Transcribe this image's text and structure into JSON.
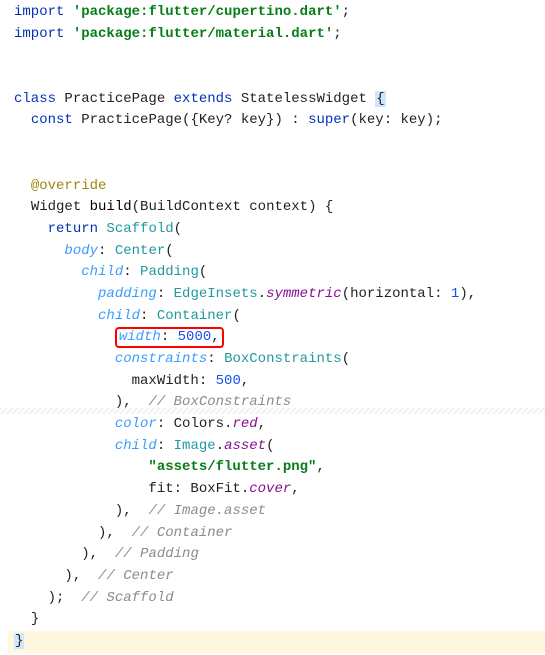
{
  "lines": {
    "l1_import": "import",
    "l1_pkg": "'package:flutter/cupertino.dart'",
    "l1_semi": ";",
    "l2_import": "import",
    "l2_pkg": "'package:flutter/material.dart'",
    "l2_semi": ";",
    "l4_class": "class",
    "l4_name": " PracticePage ",
    "l4_extends": "extends",
    "l4_parent": " StatelessWidget ",
    "l4_brace": "{",
    "l5_const": "const",
    "l5_ctor": " PracticePage({Key? key}) : ",
    "l5_super": "super",
    "l5_rest": "(key: key);",
    "l7_override": "@override",
    "l8_widget": "Widget ",
    "l8_build": "build",
    "l8_sig": "(BuildContext context) {",
    "l9_return": "return",
    "l9_scaffold": " Scaffold",
    "l9_paren": "(",
    "l10_body": "body",
    "l10_center": "Center",
    "l10_paren": "(",
    "l11_child": "child",
    "l11_padding": "Padding",
    "l11_paren": "(",
    "l12_padding": "padding",
    "l12_edge": "EdgeInsets",
    "l12_sym": "symmetric",
    "l12_horiz": "(horizontal: ",
    "l12_num": "1",
    "l12_end": "),",
    "l13_child": "child",
    "l13_container": "Container",
    "l13_paren": "(",
    "l14_width": "width",
    "l14_val": "5000",
    "l14_comma": ",",
    "l15_constraints": "constraints",
    "l15_box": "BoxConstraints",
    "l15_paren": "(",
    "l16_max": "maxWidth: ",
    "l16_val": "500",
    "l16_comma": ",",
    "l17_close": "),",
    "l17_cmt": "  // BoxConstraints",
    "l18_color": "color",
    "l18_colors": ": Colors.",
    "l18_red": "red",
    "l18_comma": ",",
    "l19_child": "child",
    "l19_image": "Image",
    "l19_asset": "asset",
    "l19_paren": "(",
    "l20_str": "\"assets/flutter.png\"",
    "l20_comma": ",",
    "l21_fit": "fit: BoxFit.",
    "l21_cover": "cover",
    "l21_comma": ",",
    "l22_close": "),",
    "l22_cmt": "  // Image.asset",
    "l23_close": "),",
    "l23_cmt": "  // Container",
    "l24_close": "),",
    "l24_cmt": "  // Padding",
    "l25_close": "),",
    "l25_cmt": "  // Center",
    "l26_close": ");",
    "l26_cmt": "  // Scaffold",
    "l27_close": "}",
    "l28_close": "}"
  }
}
